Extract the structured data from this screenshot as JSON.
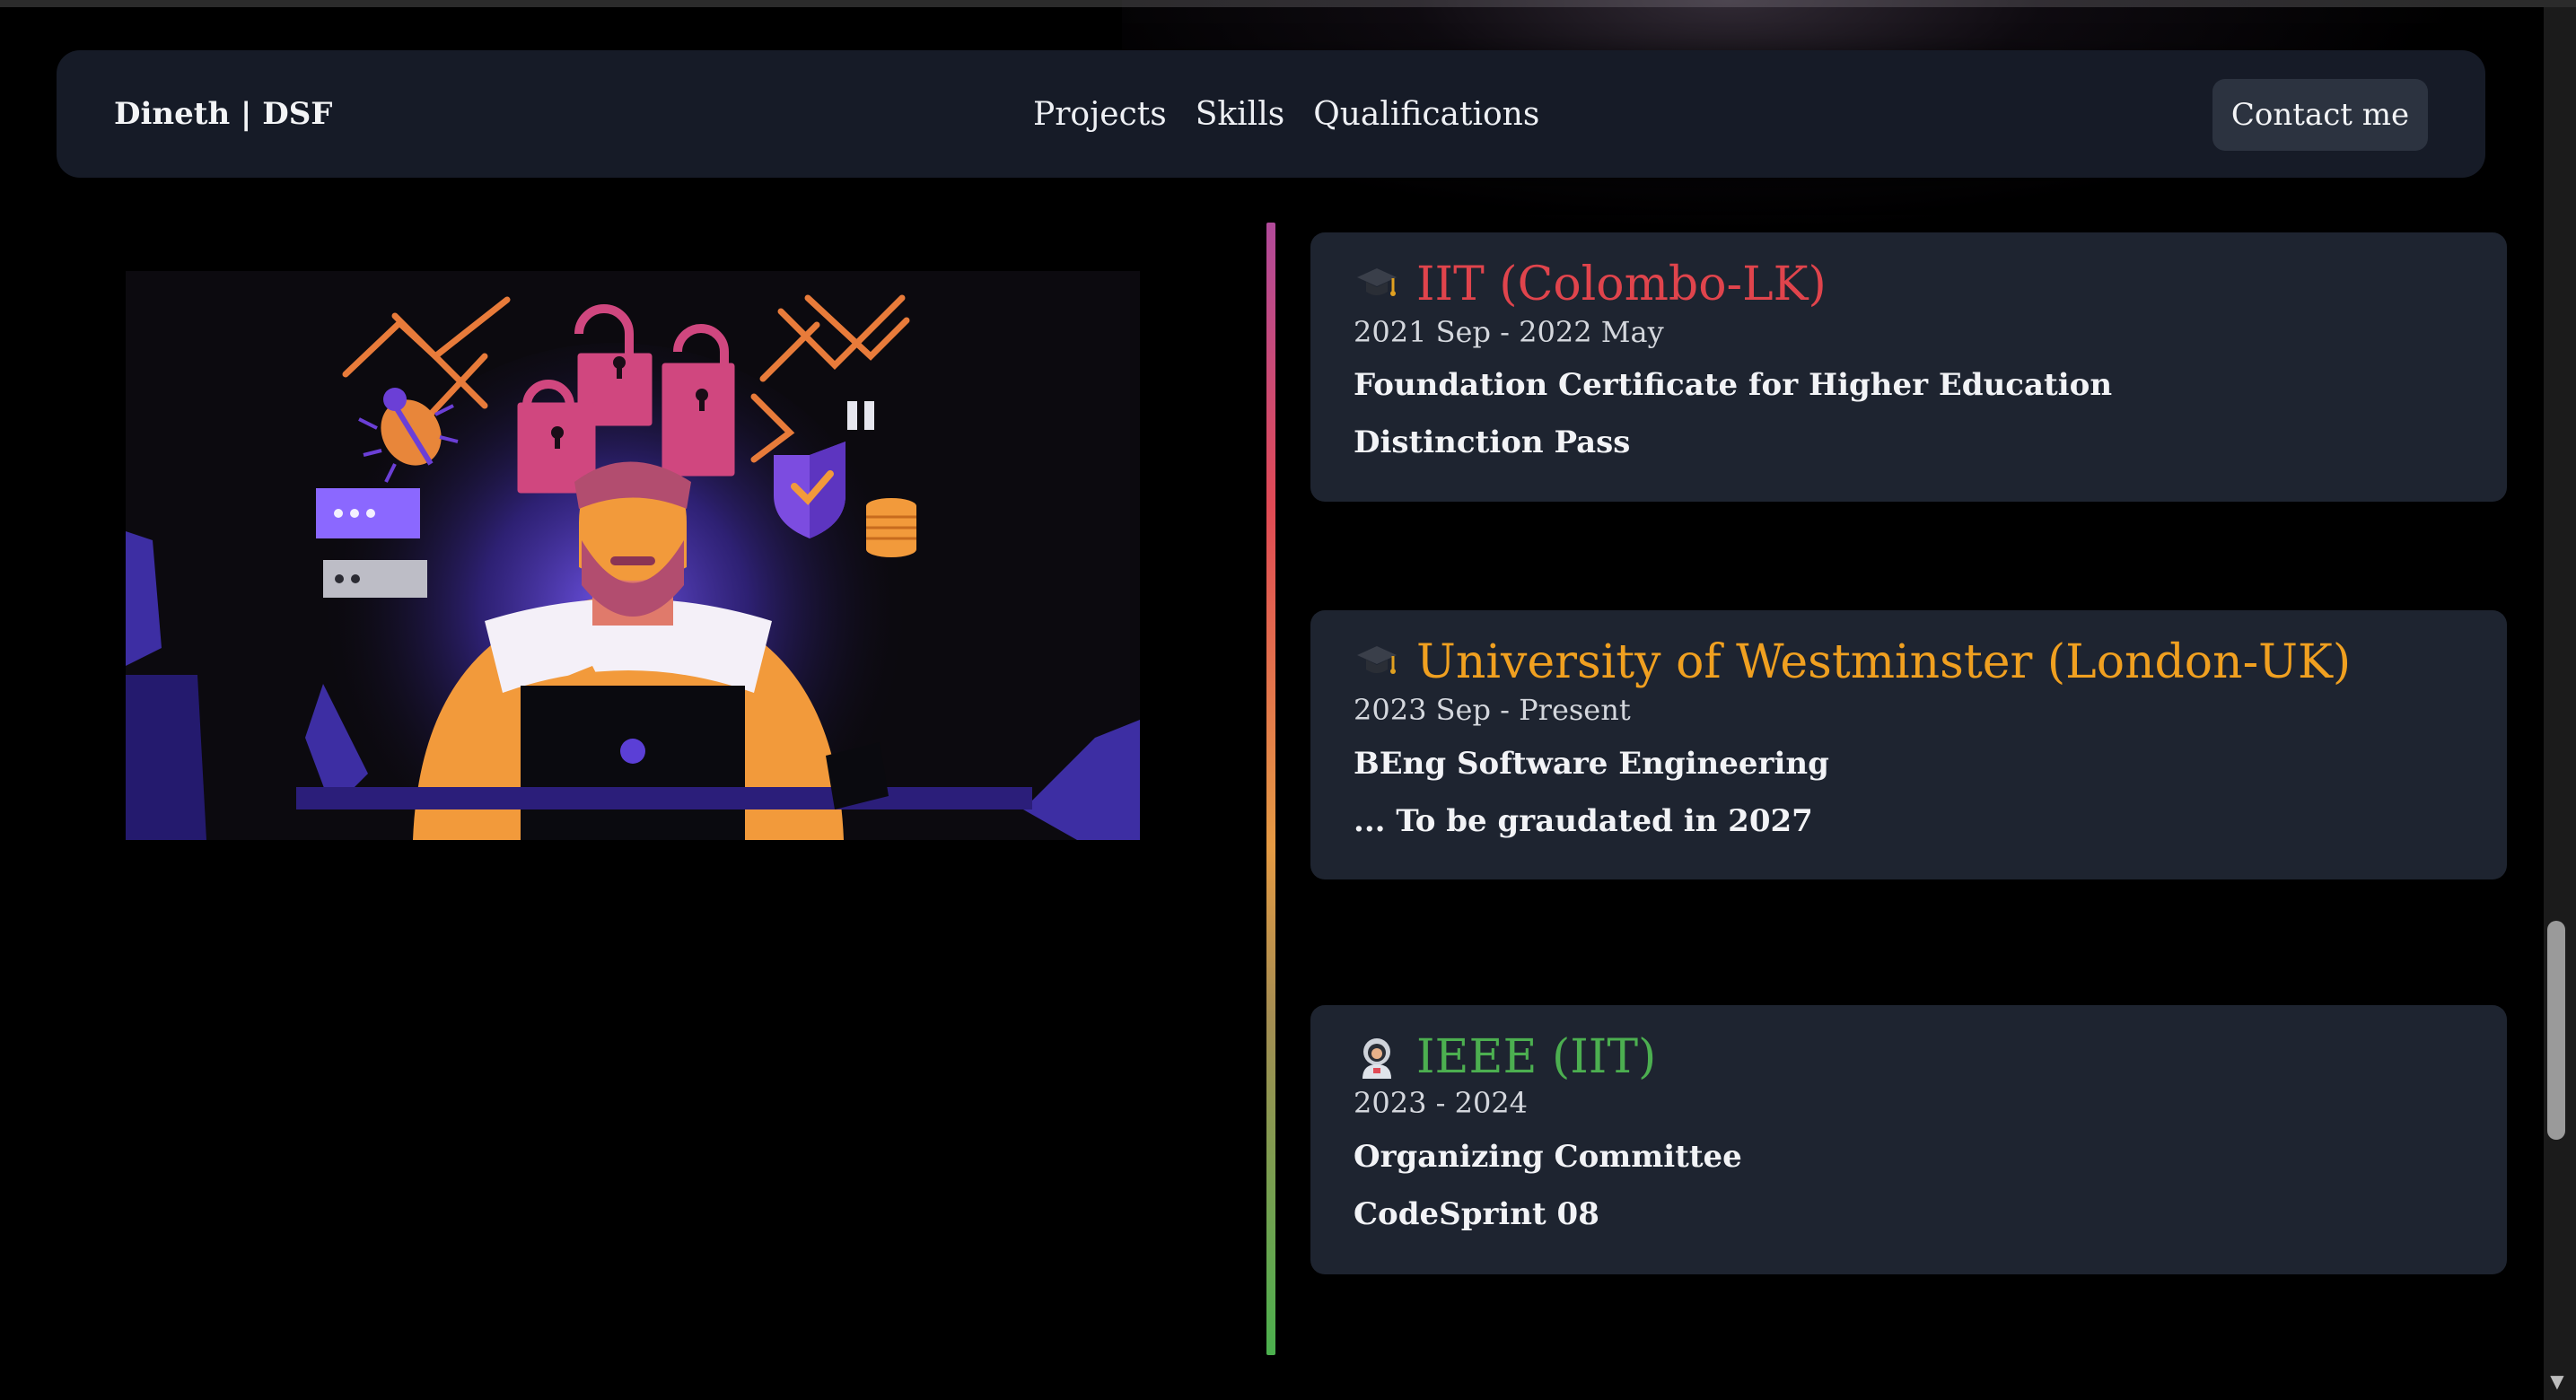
{
  "brand": "Dineth | DSF",
  "nav": {
    "links": [
      "Projects",
      "Skills",
      "Qualifications"
    ],
    "contact_label": "Contact me"
  },
  "illustration": {
    "name": "hacker-at-laptop-illustration",
    "colors": {
      "purple": "#5b3fd6",
      "pink": "#d0477f",
      "orange": "#f29a3b",
      "dark": "#0c0a0f"
    }
  },
  "timeline": {
    "items": [
      {
        "icon": "graduation-cap-icon",
        "title": "IIT (Colombo-LK)",
        "title_color": "#e0444c",
        "date": "2021 Sep - 2022 May",
        "line1": "Foundation Certificate for Higher Education",
        "line2": "Distinction Pass"
      },
      {
        "icon": "graduation-cap-icon",
        "title": "University of Westminster (London-UK)",
        "title_color": "#f0a020",
        "date": "2023 Sep - Present",
        "line1": "BEng Software Engineering",
        "line2": "... To be graudated in 2027"
      },
      {
        "icon": "astronaut-icon",
        "title": "IEEE (IIT)",
        "title_color": "#4caf50",
        "date": "2023 - 2024",
        "line1": "Organizing Committee",
        "line2": "CodeSprint 08"
      }
    ]
  }
}
